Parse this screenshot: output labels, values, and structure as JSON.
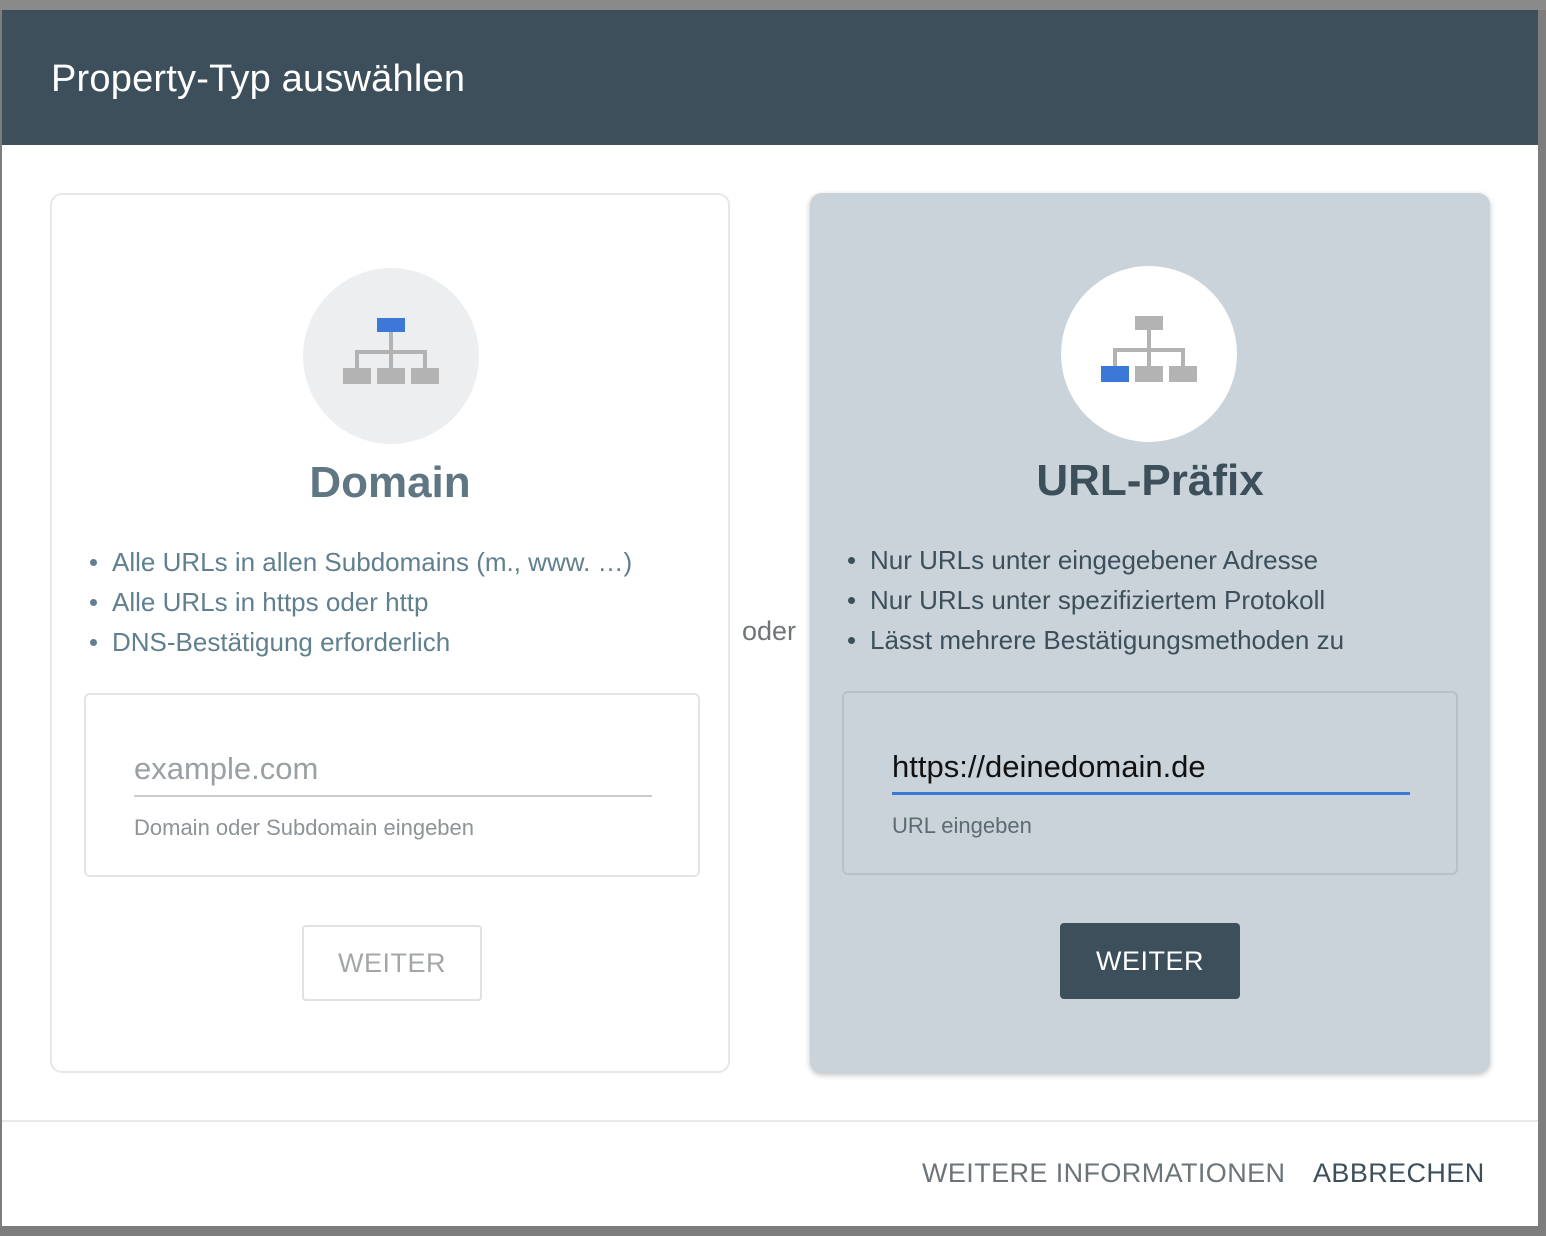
{
  "dialog": {
    "title": "Property-Typ auswählen"
  },
  "domain_card": {
    "title": "Domain",
    "bullets": [
      "Alle URLs in allen Subdomains (m., www. …)",
      "Alle URLs in https oder http",
      "DNS-Bestätigung erforderlich"
    ],
    "input_value": "",
    "input_placeholder": "example.com",
    "hint": "Domain oder Subdomain eingeben",
    "button_label": "WEITER",
    "icon": "sitemap-icon-top-highlighted"
  },
  "separator": "oder",
  "url_card": {
    "title": "URL-Präfix",
    "bullets": [
      "Nur URLs unter eingegebener Adresse",
      "Nur URLs unter spezifiziertem Protokoll",
      "Lässt mehrere Bestätigungsmethoden zu"
    ],
    "input_value": "https://deinedomain.de",
    "input_placeholder": "",
    "hint": "URL eingeben",
    "button_label": "WEITER",
    "icon": "sitemap-icon-leaf-highlighted"
  },
  "footer": {
    "more_info_label": "WEITERE INFORMATIONEN",
    "cancel_label": "ABBRECHEN"
  },
  "colors": {
    "header": "#3c4f5b",
    "accent_blue": "#3c78d8",
    "selected_card": "#cad3d9",
    "icon_gray": "#b3b3b3"
  }
}
